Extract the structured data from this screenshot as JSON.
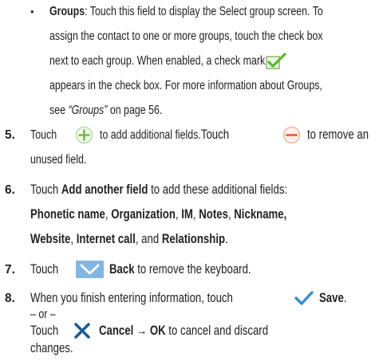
{
  "item_groups": {
    "bullet": "•",
    "term": "Groups",
    "l1": ": Touch this field to display the Select group screen. To",
    "l2": "assign the contact to one or more groups, touch the check box",
    "l3": "next to each group. When enabled, a check mark",
    "l4": "appears in the check box. For more information about Groups,",
    "l5_a": "see ",
    "l5_ref": "“Groups”",
    "l5_b": " on page 56."
  },
  "step5": {
    "num": "5.",
    "a": "Touch",
    "b": "to add additional fields.",
    "c": "Touch",
    "d": "to remove an",
    "e": "unused field."
  },
  "step6": {
    "num": "6.",
    "a": "Touch ",
    "b": "Add another field",
    "c": " to add these additional fields:",
    "f1": "Phonetic name",
    "s1": ", ",
    "f2": "Organization",
    "s2": ", ",
    "f3": "IM",
    "s3": ", ",
    "f4": "Notes",
    "s4": ", ",
    "f5": "Nickname,",
    "f6": "Website",
    "s6": ", ",
    "f7": "Internet call",
    "s7": ", and ",
    "f8": "Relationship",
    "s8": "."
  },
  "step7": {
    "num": "7.",
    "a": "Touch",
    "b": "Back",
    "c": " to remove the keyboard."
  },
  "step8": {
    "num": "8.",
    "a": "When you finish entering information, touch",
    "b": "Save",
    "c": ".",
    "or": "– or –",
    "d": "Touch",
    "e": "Cancel → OK",
    "f": " to cancel and discard",
    "g": "changes."
  },
  "icons": {
    "checkmark_box": "checkmark-box-icon",
    "plus": "plus-circle-icon",
    "minus": "minus-circle-icon",
    "keyboard_hide": "keyboard-hide-icon",
    "save": "save-check-icon",
    "cancel": "cancel-x-icon"
  },
  "colors": {
    "plus": "#6fbf3f",
    "minus": "#e8623c",
    "keyboard_icon_bg": "#7fb3e0",
    "save_check": "#3a8fc9",
    "cancel_x": "#1e5b93"
  }
}
